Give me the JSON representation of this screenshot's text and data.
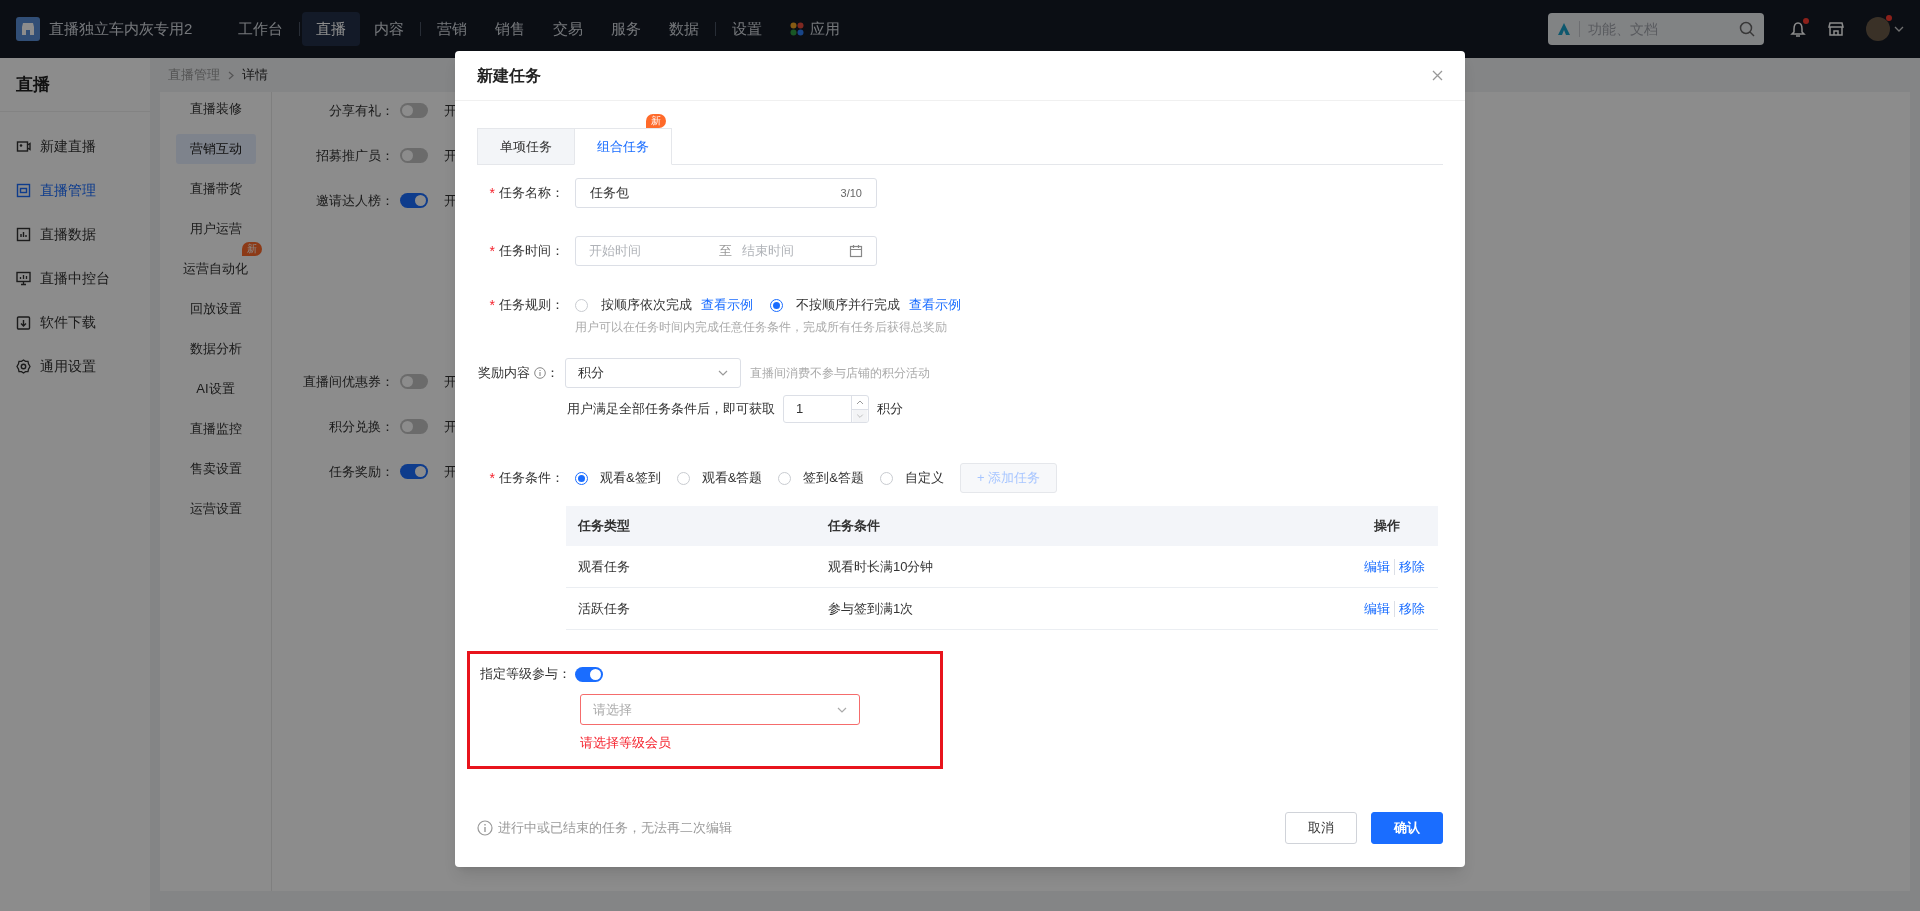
{
  "top_bar": {
    "store_name": "直播独立车内灰专用2",
    "nav": [
      {
        "label": "工作台",
        "selected": false,
        "kind": "link",
        "divider_after": true
      },
      {
        "label": "直播",
        "selected": true,
        "kind": "link",
        "divider_after": false
      },
      {
        "label": "内容",
        "selected": false,
        "kind": "link",
        "divider_after": true
      },
      {
        "label": "营销",
        "selected": false,
        "kind": "link",
        "divider_after": false
      },
      {
        "label": "销售",
        "selected": false,
        "kind": "link",
        "divider_after": false
      },
      {
        "label": "交易",
        "selected": false,
        "kind": "link",
        "divider_after": false
      },
      {
        "label": "服务",
        "selected": false,
        "kind": "link",
        "divider_after": false
      },
      {
        "label": "数据",
        "selected": false,
        "kind": "link",
        "divider_after": true
      },
      {
        "label": "设置",
        "selected": false,
        "kind": "link",
        "divider_after": false
      },
      {
        "label": "应用",
        "selected": false,
        "kind": "apps",
        "divider_after": false
      }
    ],
    "search": {
      "placeholder": "功能、文档"
    }
  },
  "sidebar": {
    "title": "直播",
    "items": [
      {
        "label": "新建直播",
        "selected": false,
        "kind": "camera"
      },
      {
        "label": "直播管理",
        "selected": true,
        "kind": "screen"
      },
      {
        "label": "直播数据",
        "selected": false,
        "kind": "chart"
      },
      {
        "label": "直播中控台",
        "selected": false,
        "kind": "monitor"
      },
      {
        "label": "软件下载",
        "selected": false,
        "kind": "download"
      },
      {
        "label": "通用设置",
        "selected": false,
        "kind": "gear"
      }
    ]
  },
  "breadcrumb": [
    "直播管理",
    "详情"
  ],
  "sub_nav": [
    {
      "label": "直播装修",
      "selected": false
    },
    {
      "label": "营销互动",
      "selected": true
    },
    {
      "label": "直播带货",
      "selected": false
    },
    {
      "label": "用户运营",
      "selected": false
    },
    {
      "label": "运营自动化",
      "selected": false,
      "badge": "新"
    },
    {
      "label": "回放设置",
      "selected": false
    },
    {
      "label": "数据分析",
      "selected": false
    },
    {
      "label": "AI设置",
      "selected": false
    },
    {
      "label": "直播监控",
      "selected": false
    },
    {
      "label": "售卖设置",
      "selected": false
    },
    {
      "label": "运营设置",
      "selected": false
    }
  ],
  "settings_groups": [
    [
      {
        "label": "分享有礼：",
        "on": false,
        "state_text": "开"
      },
      {
        "label": "招募推广员：",
        "on": false,
        "state_text": "开"
      },
      {
        "label": "邀请达人榜：",
        "on": true,
        "state_text": "开"
      }
    ],
    [
      {
        "label": "直播间优惠券：",
        "on": false,
        "state_text": "开"
      },
      {
        "label": "积分兑换：",
        "on": false,
        "state_text": "开"
      },
      {
        "label": "任务奖励：",
        "on": true,
        "state_text": "开"
      }
    ]
  ],
  "modal": {
    "title": "新建任务",
    "tabs": [
      {
        "label": "单项任务",
        "selected": false
      },
      {
        "label": "组合任务",
        "selected": true,
        "badge": "新"
      }
    ],
    "name_field": {
      "label": "任务名称：",
      "required_mark": "*",
      "value": "任务包",
      "count": "3/10"
    },
    "time_field": {
      "label": "任务时间：",
      "required_mark": "*",
      "start_placeholder": "开始时间",
      "separator": "至",
      "end_placeholder": "结束时间"
    },
    "rule": {
      "label": "任务规则：",
      "required_mark": "*",
      "options": [
        {
          "label": "按顺序依次完成",
          "selected": false,
          "link": "查看示例"
        },
        {
          "label": "不按顺序并行完成",
          "selected": true,
          "link": "查看示例"
        }
      ],
      "hint": "用户可以在任务时间内完成任意任务条件，完成所有任务后获得总奖励"
    },
    "reward": {
      "label": "奖励内容",
      "suffix": "：",
      "value": "积分",
      "note": "直播间消费不参与店铺的积分活动",
      "amount_prefix": "用户满足全部任务条件后，即可获取",
      "amount_value": "1",
      "amount_unit": "积分"
    },
    "condition": {
      "label": "任务条件：",
      "required_mark": "*",
      "options": [
        {
          "label": "观看&签到",
          "selected": true
        },
        {
          "label": "观看&答题",
          "selected": false
        },
        {
          "label": "签到&答题",
          "selected": false
        },
        {
          "label": "自定义",
          "selected": false
        }
      ],
      "add_button": {
        "label": "+ 添加任务",
        "disabled": true
      }
    },
    "table": {
      "columns": [
        "任务类型",
        "任务条件",
        "操作"
      ],
      "rows": [
        {
          "cells": [
            "观看任务",
            "观看时长满10分钟"
          ],
          "actions": [
            "编辑",
            "移除"
          ]
        },
        {
          "cells": [
            "活跃任务",
            "参与签到满1次"
          ],
          "actions": [
            "编辑",
            "移除"
          ]
        }
      ]
    },
    "level": {
      "label": "指定等级参与：",
      "on": true,
      "placeholder": "请选择",
      "error": "请选择等级会员",
      "highlighted": true
    },
    "footer": {
      "note": "进行中或已结束的任务，无法再二次编辑",
      "buttons": [
        {
          "label": "取消",
          "kind": "default"
        },
        {
          "label": "确认",
          "kind": "primary"
        }
      ]
    }
  }
}
